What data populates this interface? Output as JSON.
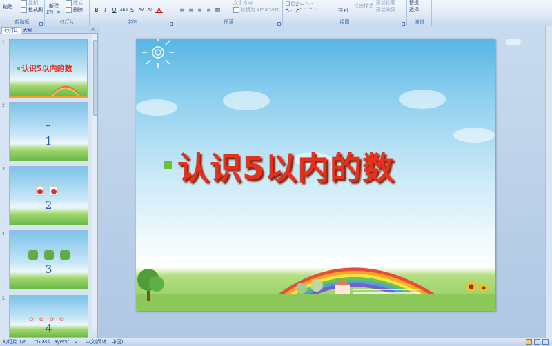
{
  "ribbon": {
    "clipboard": {
      "paste": "粘贴",
      "copy": "复制",
      "format_painter": "格式刷",
      "label": "剪贴板"
    },
    "slides": {
      "new_slide": "新建",
      "new_slide2": "幻灯片",
      "layout": "版式",
      "delete": "删除",
      "label": "幻灯片"
    },
    "font": {
      "label": "字体",
      "buttons": [
        "B",
        "I",
        "U",
        "abe",
        "S",
        "AV",
        "Aa",
        "A"
      ]
    },
    "paragraph": {
      "label": "段落",
      "text_direction": "文字方向",
      "convert_smartart": "转换为 SmartArt"
    },
    "drawing": {
      "label": "绘图",
      "arrange": "排列",
      "quick_styles": "快速样式",
      "shape_fill": "形状轮廓",
      "shape_effect": "形状效果"
    },
    "editing": {
      "label": "编辑",
      "replace": "替换",
      "select": "选择"
    }
  },
  "panel": {
    "tabs": [
      "幻灯片",
      "大纲"
    ],
    "close": "×",
    "slides": [
      {
        "num": "1",
        "title": "认识5以内的数"
      },
      {
        "num": "2",
        "big": "1"
      },
      {
        "num": "3",
        "big": "2"
      },
      {
        "num": "4",
        "big": "3"
      },
      {
        "num": "5",
        "big": "4"
      }
    ]
  },
  "slide": {
    "title": "认识5以内的数"
  },
  "status": {
    "slide_count": "幻灯片 1/6",
    "theme": "\"Glass Layers\"",
    "language": "中文(简体，中国)"
  },
  "colors": {
    "title_red": "#e8301c",
    "bullet_green": "#63c23a",
    "accent_orange": "#f0a030"
  }
}
